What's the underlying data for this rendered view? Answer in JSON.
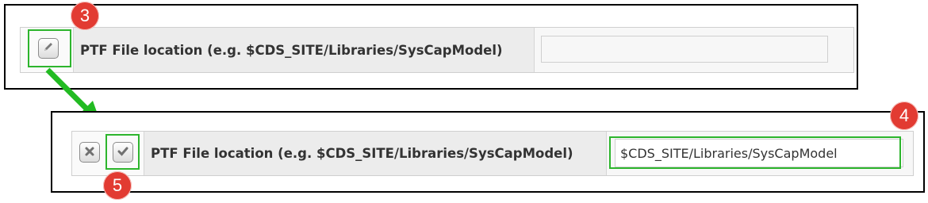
{
  "step_before": {
    "label": "PTF File location (e.g. $CDS_SITE/Libraries/SysCapModel)",
    "input_value": "",
    "badge": "3"
  },
  "step_after": {
    "label": "PTF File location (e.g. $CDS_SITE/Libraries/SysCapModel)",
    "input_value": "$CDS_SITE/Libraries/SysCapModel",
    "badge_input": "4",
    "badge_confirm": "5"
  },
  "icons": {
    "edit": "pencil-icon",
    "cancel": "close-icon",
    "confirm": "check-icon"
  },
  "colors": {
    "highlight": "#2db52d",
    "badge": "#e23b32",
    "arrow": "#22bb22"
  }
}
